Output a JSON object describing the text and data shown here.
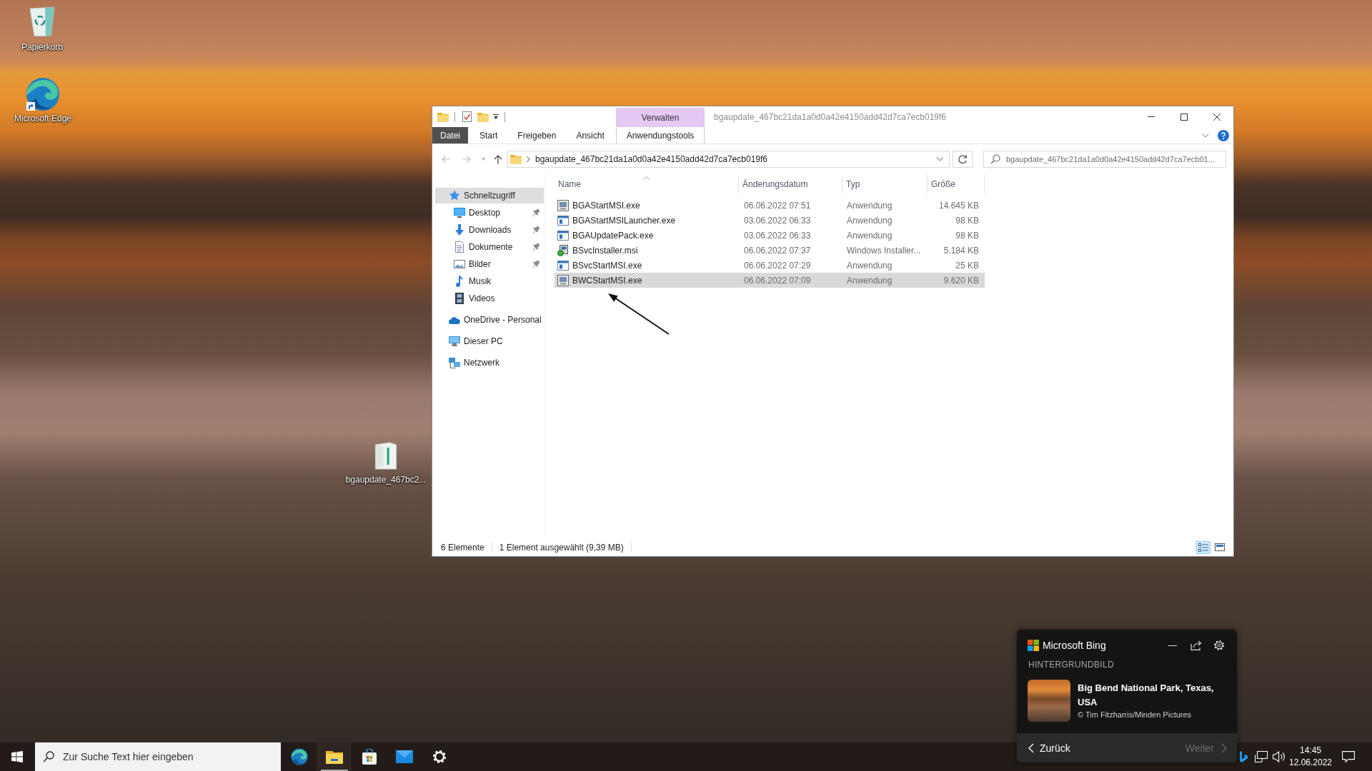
{
  "desktop": {
    "icons": [
      {
        "label": "Papierkorb",
        "kind": "recycle"
      },
      {
        "label": "Microsoft Edge",
        "kind": "browser"
      },
      {
        "label": "bgaupdate_467bc2...",
        "kind": "archive"
      }
    ]
  },
  "explorer": {
    "context_header": "Verwalten",
    "title": "bgaupdate_467bc21da1a0d0a42e4150add42d7ca7ecb019f6",
    "ribbon_tabs": [
      {
        "label": "Datei",
        "kind": "file"
      },
      {
        "label": "Start",
        "kind": "tab"
      },
      {
        "label": "Freigeben",
        "kind": "tab"
      },
      {
        "label": "Ansicht",
        "kind": "tab"
      },
      {
        "label": "Anwendungstools",
        "kind": "context"
      }
    ],
    "address": {
      "path": "bgaupdate_467bc21da1a0d0a42e4150add42d7ca7ecb019f6"
    },
    "search": {
      "placeholder": "bgaupdate_467bc21da1a0d0a42e4150add42d7ca7ecb01..."
    },
    "navigation": [
      {
        "label": "Schnellzugriff",
        "kind": "star",
        "selected": true,
        "children": [
          {
            "label": "Desktop",
            "kind": "desktop",
            "selected": false,
            "pinned": true
          },
          {
            "label": "Downloads",
            "kind": "download",
            "selected": false,
            "pinned": true
          },
          {
            "label": "Dokumente",
            "kind": "document",
            "selected": false,
            "pinned": true
          },
          {
            "label": "Bilder",
            "kind": "pictures",
            "selected": false,
            "pinned": true
          },
          {
            "label": "Musik",
            "kind": "music",
            "selected": false,
            "pinned": false
          },
          {
            "label": "Videos",
            "kind": "videos",
            "selected": false,
            "pinned": false
          }
        ]
      },
      {
        "label": "OneDrive - Personal",
        "kind": "cloud",
        "selected": false
      },
      {
        "label": "Dieser PC",
        "kind": "pc",
        "selected": false
      },
      {
        "label": "Netzwerk",
        "kind": "network",
        "selected": false
      }
    ],
    "columns": [
      {
        "label": "Name",
        "sorted": true
      },
      {
        "label": "Änderungsdatum",
        "sorted": false
      },
      {
        "label": "Typ",
        "sorted": false
      },
      {
        "label": "Größe",
        "sorted": false
      }
    ],
    "rows": [
      {
        "name": "BGAStartMSI.exe",
        "date": "06.06.2022 07:51",
        "type": "Anwendung",
        "size": "14.645 KB",
        "kind": "setup",
        "selected": false
      },
      {
        "name": "BGAStartMSILauncher.exe",
        "date": "03.06.2022 06:33",
        "type": "Anwendung",
        "size": "98 KB",
        "kind": "app",
        "selected": false
      },
      {
        "name": "BGAUpdatePack.exe",
        "date": "03.06.2022 06:33",
        "type": "Anwendung",
        "size": "98 KB",
        "kind": "app",
        "selected": false
      },
      {
        "name": "BSvcInstaller.msi",
        "date": "06.06.2022 07:37",
        "type": "Windows Installer...",
        "size": "5.184 KB",
        "kind": "msi",
        "selected": false
      },
      {
        "name": "BSvcStartMSI.exe",
        "date": "06.06.2022 07:29",
        "type": "Anwendung",
        "size": "25 KB",
        "kind": "app",
        "selected": false
      },
      {
        "name": "BWCStartMSI.exe",
        "date": "06.06.2022 07:09",
        "type": "Anwendung",
        "size": "9.620 KB",
        "kind": "setup",
        "selected": true
      }
    ],
    "status_bar": {
      "item_count": "6 Elemente",
      "selection": "1 Element ausgewählt (9,39 MB)"
    },
    "view_buttons": [
      {
        "kind": "details",
        "selected": true
      },
      {
        "kind": "large_icons",
        "selected": false
      }
    ]
  },
  "bing_popup": {
    "brand": "Microsoft Bing",
    "section": "HINTERGRUNDBILD",
    "title": "Big Bend National Park, Texas, USA",
    "credit": "© Tim Fitzharris/Minden Pictures",
    "nav_buttons": [
      {
        "label": "Zurück",
        "kind": "back",
        "disabled": false
      },
      {
        "label": "Weiter",
        "kind": "next",
        "disabled": true
      }
    ]
  },
  "taskbar": {
    "search": {
      "placeholder": "Zur Suche Text hier eingeben"
    },
    "apps": [
      {
        "kind": "browser",
        "active": false
      },
      {
        "kind": "explorer",
        "active": true
      },
      {
        "kind": "store",
        "active": false
      },
      {
        "kind": "mail",
        "active": false
      },
      {
        "kind": "settings",
        "active": false
      }
    ],
    "clock": {
      "time": "14:45",
      "date": "12.06.2022"
    }
  }
}
